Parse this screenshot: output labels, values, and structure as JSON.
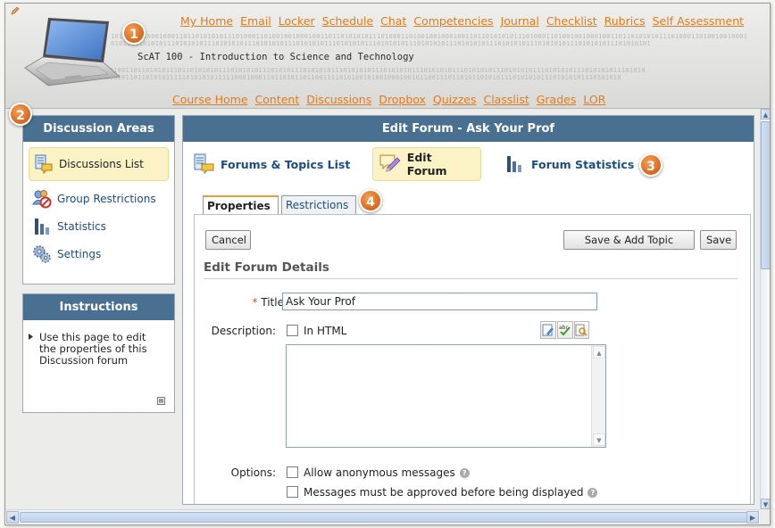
{
  "header": {
    "binary_lines": [
      "10100100100010001101101010101110100011010010010001001101101010101110100011010010010001001101101010101110100011010010010001001101101010101110100011010010010001",
      "01011011010101110101010111010101011101010101110101010111010101011101010101110101010111010101011101010101110101010111010101011101010101",
      "00100110110101011101101010101110101010111010101110101010111010101011101010101110101010111010101011101010101110101010111010101011101010",
      "10010110110101011111010101011111000100011011010110110011110101001010010001001011001110110101101010111010101011101010101110101010"
    ],
    "course_name": "ScAT 100 - Introduction to Science and Technology",
    "top_nav": [
      "My Home",
      "Email",
      "Locker",
      "Schedule",
      "Chat",
      "Competencies",
      "Journal",
      "Checklist",
      "Rubrics",
      "Self Assessment"
    ],
    "course_nav": [
      "Course Home",
      "Content",
      "Discussions",
      "Dropbox",
      "Quizzes",
      "Classlist",
      "Grades",
      "LOR"
    ]
  },
  "callouts": [
    "1",
    "2",
    "3",
    "4"
  ],
  "sidebar": {
    "title": "Discussion Areas",
    "items": [
      {
        "label": "Discussions List",
        "icon": "discussions-list-icon"
      },
      {
        "label": "Group Restrictions",
        "icon": "group-restrictions-icon"
      },
      {
        "label": "Statistics",
        "icon": "statistics-icon"
      },
      {
        "label": "Settings",
        "icon": "settings-icon"
      }
    ]
  },
  "instructions": {
    "title": "Instructions",
    "text": "Use this page to edit the properties of this Discussion forum"
  },
  "main": {
    "title": "Edit Forum - Ask Your Prof",
    "subnav": [
      {
        "label": "Forums & Topics List",
        "icon": "forums-topics-icon"
      },
      {
        "label": "Edit Forum",
        "icon": "edit-forum-icon"
      },
      {
        "label": "Forum Statistics",
        "icon": "forum-statistics-icon"
      }
    ],
    "tabs": [
      "Properties",
      "Restrictions"
    ]
  },
  "form": {
    "cancel_label": "Cancel",
    "save_add_topic_label": "Save & Add Topic",
    "save_label": "Save",
    "section_heading": "Edit Forum Details",
    "title_required_marker": "*",
    "title_label": "Title:",
    "title_value": "Ask Your Prof",
    "description_label": "Description:",
    "in_html_label": "In HTML",
    "options_label": "Options:",
    "option_anonymous": "Allow anonymous messages",
    "option_approval": "Messages must be approved before being displayed"
  },
  "colors": {
    "header_bar": "#496f91",
    "accent_orange": "#e07d1c",
    "link_blue": "#1a4d82",
    "active_highlight": "#fbf2c6"
  }
}
